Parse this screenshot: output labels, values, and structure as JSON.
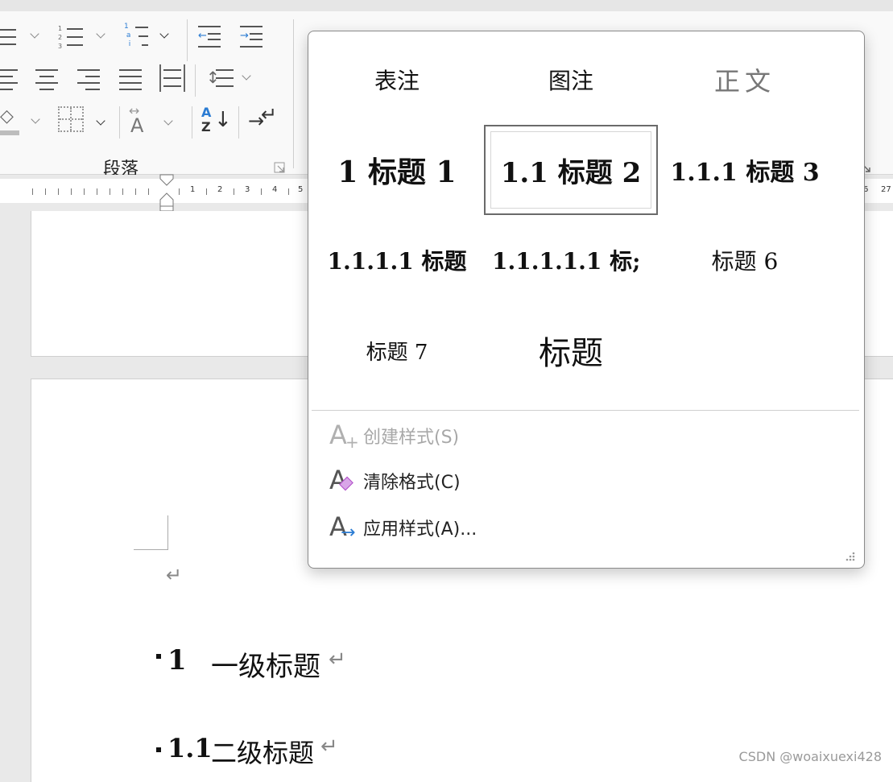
{
  "ribbon": {
    "group_label": "段落"
  },
  "ruler": {
    "numbers": [
      "1",
      "2",
      "3",
      "4",
      "5"
    ],
    "right_numbers": [
      "6",
      "27"
    ]
  },
  "gallery": {
    "styles": [
      {
        "label": "表注"
      },
      {
        "label": "图注"
      },
      {
        "label": "正文"
      },
      {
        "label": "1  标题 1"
      },
      {
        "label": "1.1  标题 2",
        "selected": true
      },
      {
        "label": "1.1.1  标题 3"
      },
      {
        "label": "1.1.1.1  标题"
      },
      {
        "label": "1.1.1.1.1  标;"
      },
      {
        "label": "标题 6"
      },
      {
        "label": "标题 7"
      },
      {
        "label": "标题"
      }
    ],
    "menu": {
      "create_style": "创建样式(S)",
      "clear_format": "清除格式(C)",
      "apply_style": "应用样式(A)..."
    }
  },
  "document": {
    "heading1_num": "1",
    "heading1_text": "一级标题",
    "heading2_num": "1.1",
    "heading2_text": "二级标题",
    "para_mark": "↵"
  },
  "watermark": "CSDN @woaixuexi428",
  "colors": {
    "accent_blue": "#2b7cd3",
    "eraser_purple": "#b24fc9"
  }
}
